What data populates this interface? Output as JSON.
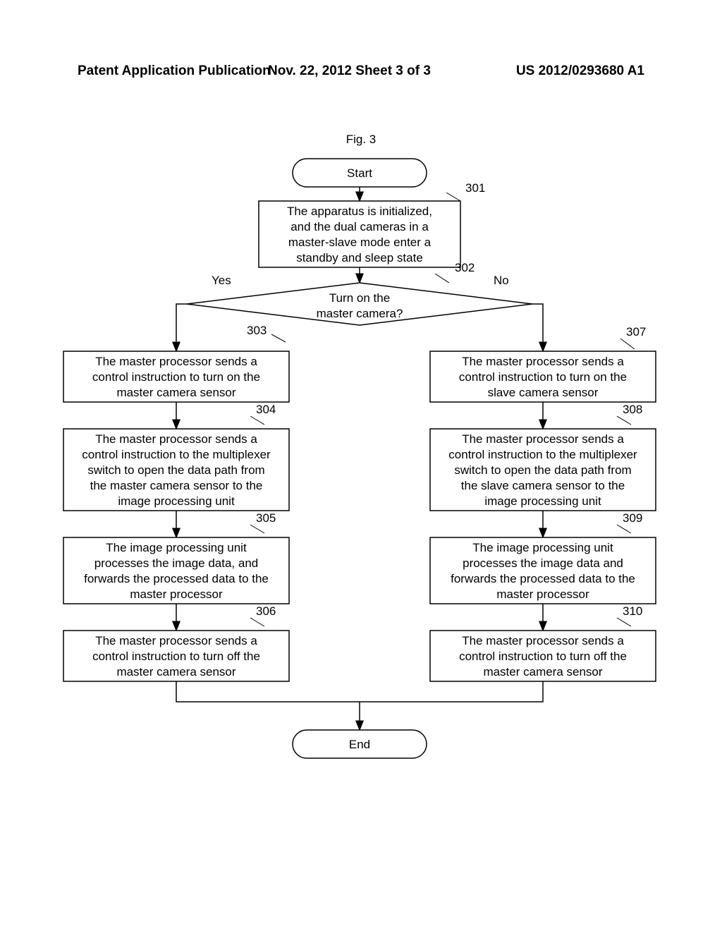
{
  "header": {
    "left": "Patent Application Publication",
    "center": "Nov. 22, 2012  Sheet 3 of 3",
    "right": "US 2012/0293680 A1"
  },
  "figtitle": "Fig. 3",
  "flow": {
    "start": "Start",
    "end": "End",
    "n301": {
      "ref": "301",
      "l1": "The apparatus is initialized,",
      "l2": "and the dual cameras in a",
      "l3": "master-slave mode enter a",
      "l4": "standby and sleep state"
    },
    "n302": {
      "ref": "302",
      "l1": "Turn on the",
      "l2": "master camera?",
      "yes": "Yes",
      "no": "No"
    },
    "n303": {
      "ref": "303",
      "l1": "The master processor sends a",
      "l2": "control instruction to turn on the",
      "l3": "master camera sensor"
    },
    "n304": {
      "ref": "304",
      "l1": "The master processor sends a",
      "l2": "control instruction to the multiplexer",
      "l3": "switch to open the data path from",
      "l4": "the master camera sensor to the",
      "l5": "image processing unit"
    },
    "n305": {
      "ref": "305",
      "l1": "The image processing unit",
      "l2": "processes the image data, and",
      "l3": "forwards the processed data to the",
      "l4": "master processor"
    },
    "n306": {
      "ref": "306",
      "l1": "The master processor sends a",
      "l2": "control instruction to turn off the",
      "l3": "master camera sensor"
    },
    "n307": {
      "ref": "307",
      "l1": "The master processor sends a",
      "l2": "control instruction to turn on the",
      "l3": "slave camera sensor"
    },
    "n308": {
      "ref": "308",
      "l1": "The master processor sends a",
      "l2": "control instruction to the multiplexer",
      "l3": "switch to open the data path from",
      "l4": "the slave camera sensor to the",
      "l5": "image processing unit"
    },
    "n309": {
      "ref": "309",
      "l1": "The image processing unit",
      "l2": "processes the image data and",
      "l3": "forwards the processed data to the",
      "l4": "master processor"
    },
    "n310": {
      "ref": "310",
      "l1": "The master processor sends a",
      "l2": "control instruction to turn off the",
      "l3": "master camera sensor"
    }
  }
}
